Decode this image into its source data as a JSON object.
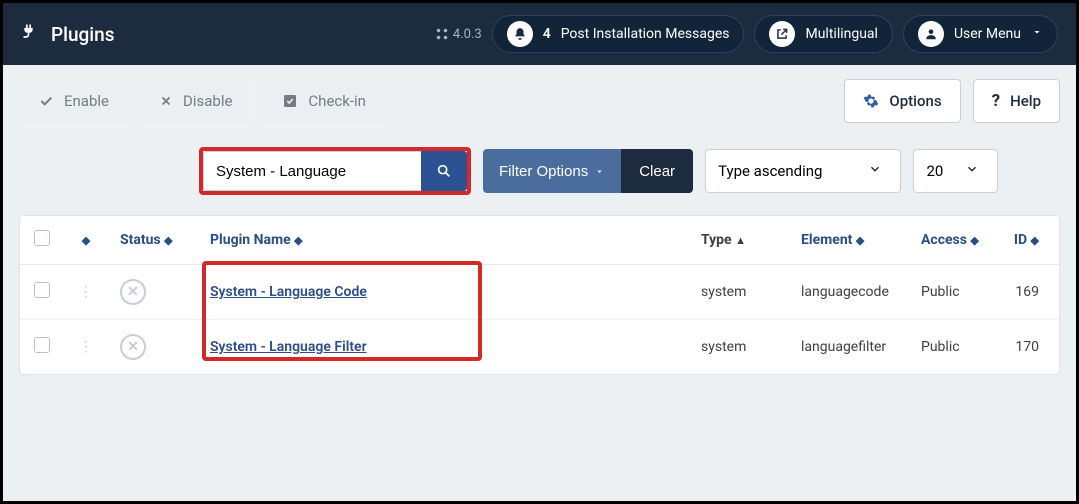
{
  "header": {
    "title": "Plugins",
    "version": "4.0.3",
    "notifications": {
      "count": "4",
      "label": "Post Installation Messages"
    },
    "multilingual": "Multilingual",
    "usermenu": "User Menu"
  },
  "toolbar": {
    "enable": "Enable",
    "disable": "Disable",
    "checkin": "Check-in",
    "options": "Options",
    "help": "Help"
  },
  "filters": {
    "search_value": "System - Language",
    "filter_options": "Filter Options",
    "clear": "Clear",
    "sort": "Type ascending",
    "limit": "20"
  },
  "table": {
    "headers": {
      "status": "Status",
      "name": "Plugin Name",
      "type": "Type",
      "element": "Element",
      "access": "Access",
      "id": "ID"
    },
    "rows": [
      {
        "name": "System - Language Code",
        "type": "system",
        "element": "languagecode",
        "access": "Public",
        "id": "169"
      },
      {
        "name": "System - Language Filter",
        "type": "system",
        "element": "languagefilter",
        "access": "Public",
        "id": "170"
      }
    ]
  }
}
